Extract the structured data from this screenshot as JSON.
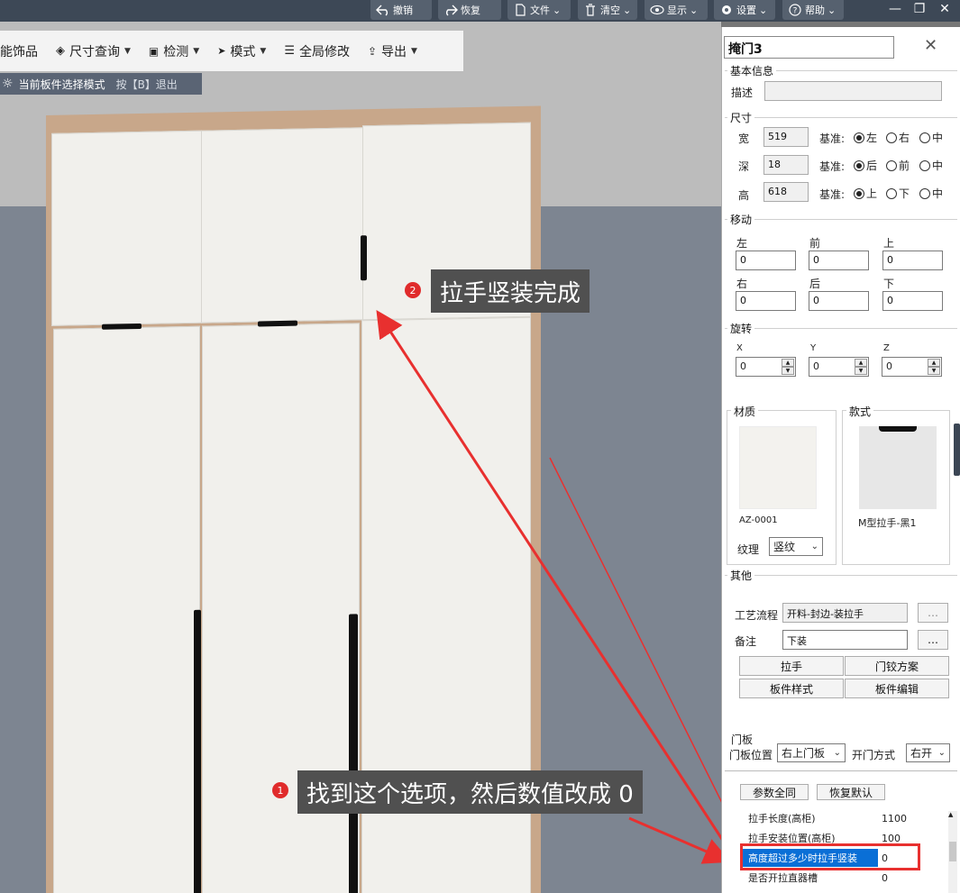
{
  "topbar": {
    "buttons": [
      {
        "label": "撤销",
        "icon": "undo-icon"
      },
      {
        "label": "恢复",
        "icon": "redo-icon"
      },
      {
        "label": "文件",
        "icon": "file-icon"
      },
      {
        "label": "清空",
        "icon": "trash-icon"
      },
      {
        "label": "显示",
        "icon": "eye-icon"
      },
      {
        "label": "设置",
        "icon": "gear-icon"
      },
      {
        "label": "帮助",
        "icon": "help-icon"
      }
    ],
    "window": {
      "minimize": "—",
      "maximize": "❐",
      "close": "✕"
    }
  },
  "toolbar2": {
    "items": [
      "能饰品",
      "尺寸查询",
      "检测",
      "模式",
      "全局修改",
      "导出"
    ]
  },
  "modebar": {
    "text": "当前板件选择模式",
    "hint": "按【B】退出"
  },
  "callouts": [
    {
      "badge": "2",
      "text": "拉手竖装完成"
    },
    {
      "badge": "1",
      "text": "找到这个选项，然后数值改成 0"
    }
  ],
  "panel": {
    "title": "掩门3",
    "close": "✕",
    "basic": {
      "section": "基本信息",
      "desc_label": "描述",
      "desc_value": ""
    },
    "size": {
      "section": "尺寸",
      "rows": [
        {
          "label": "宽",
          "value": "519",
          "ref": "基准:",
          "options": [
            "左",
            "右",
            "中"
          ],
          "selected": 0
        },
        {
          "label": "深",
          "value": "18",
          "ref": "基准:",
          "options": [
            "后",
            "前",
            "中"
          ],
          "selected": 0
        },
        {
          "label": "高",
          "value": "618",
          "ref": "基准:",
          "options": [
            "上",
            "下",
            "中"
          ],
          "selected": 0
        }
      ]
    },
    "move": {
      "section": "移动",
      "fields": [
        {
          "label": "左",
          "value": "0"
        },
        {
          "label": "前",
          "value": "0"
        },
        {
          "label": "上",
          "value": "0"
        },
        {
          "label": "右",
          "value": "0"
        },
        {
          "label": "后",
          "value": "0"
        },
        {
          "label": "下",
          "value": "0"
        }
      ]
    },
    "rotate": {
      "section": "旋转",
      "fields": [
        {
          "label": "X",
          "value": "0"
        },
        {
          "label": "Y",
          "value": "0"
        },
        {
          "label": "Z",
          "value": "0"
        }
      ]
    },
    "material": {
      "section": "材质",
      "code": "AZ-0001",
      "texture_label": "纹理",
      "texture_value": "竖纹"
    },
    "style": {
      "section": "款式",
      "name": "M型拉手-黑1"
    },
    "other": {
      "section": "其他",
      "process_label": "工艺流程",
      "process_value": "开料-封边-装拉手",
      "note_label": "备注",
      "note_value": "下装",
      "more": "…",
      "buttons": [
        "拉手",
        "门铰方案",
        "板件样式",
        "板件编辑"
      ]
    },
    "door": {
      "section": "门板",
      "pos_label": "门板位置",
      "pos_value": "右上门板",
      "open_label": "开门方式",
      "open_value": "右开"
    },
    "params": {
      "btn_all": "参数全同",
      "btn_reset": "恢复默认",
      "rows": [
        {
          "key": "拉手长度(高柜)",
          "value": "1100"
        },
        {
          "key": "拉手安装位置(高柜)",
          "value": "100"
        },
        {
          "key": "高度超过多少时拉手竖装",
          "value": "0"
        },
        {
          "key": "是否开拉直器槽",
          "value": "0"
        }
      ]
    }
  },
  "colors": {
    "accent_red": "#e02b2b",
    "selection_blue": "#0a6fd6",
    "topbar": "#3d4856"
  }
}
